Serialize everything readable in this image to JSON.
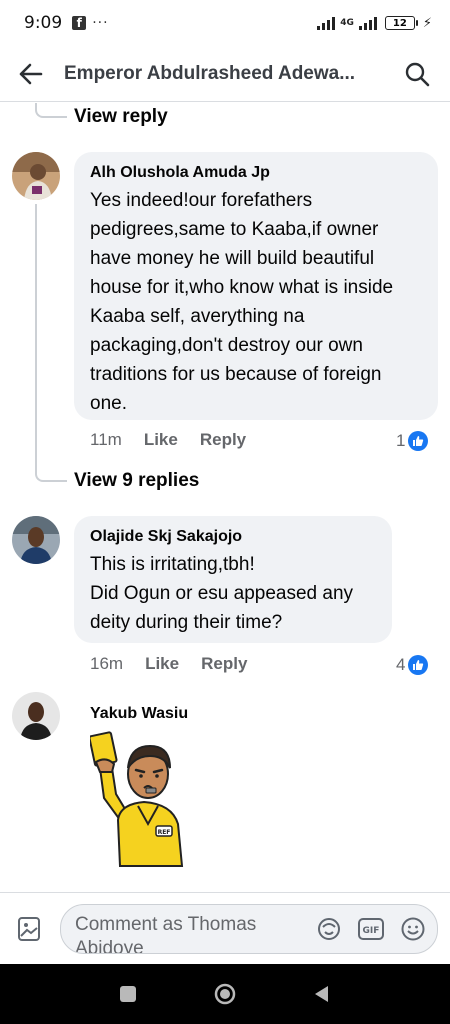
{
  "status_bar": {
    "time": "9:09",
    "dots": "···",
    "network": "4G",
    "battery": "12"
  },
  "header": {
    "title": "Emperor Abdulrasheed Adewa..."
  },
  "thread": {
    "view_reply_label": "View reply",
    "view_replies_label": "View 9 replies"
  },
  "comments": [
    {
      "author": "Alh Olushola Amuda Jp",
      "text": "Yes indeed!our forefathers pedigrees,same to Kaaba,if owner have money he will build beautiful house for it,who know what is inside Kaaba self, averything na packaging,don't destroy our own traditions for us because of foreign one.",
      "time": "11m",
      "like_label": "Like",
      "reply_label": "Reply",
      "reaction_count": "1"
    },
    {
      "author": "Olajide Skj Sakajojo",
      "text": "This is irritating,tbh!\nDid Ogun or esu appeased any deity during their time?",
      "time": "16m",
      "like_label": "Like",
      "reply_label": "Reply",
      "reaction_count": "4"
    },
    {
      "author": "Yakub Wasiu",
      "sticker": "referee-yellow-card-sticker",
      "sticker_badge": "REF"
    }
  ],
  "composer": {
    "placeholder": "Comment as Thomas Abidoye",
    "gif_label": "GIF"
  },
  "colors": {
    "accent": "#1877f2",
    "bubble": "#f0f2f5",
    "secondary_text": "#65676b",
    "sticker_shirt": "#f5d21f"
  }
}
